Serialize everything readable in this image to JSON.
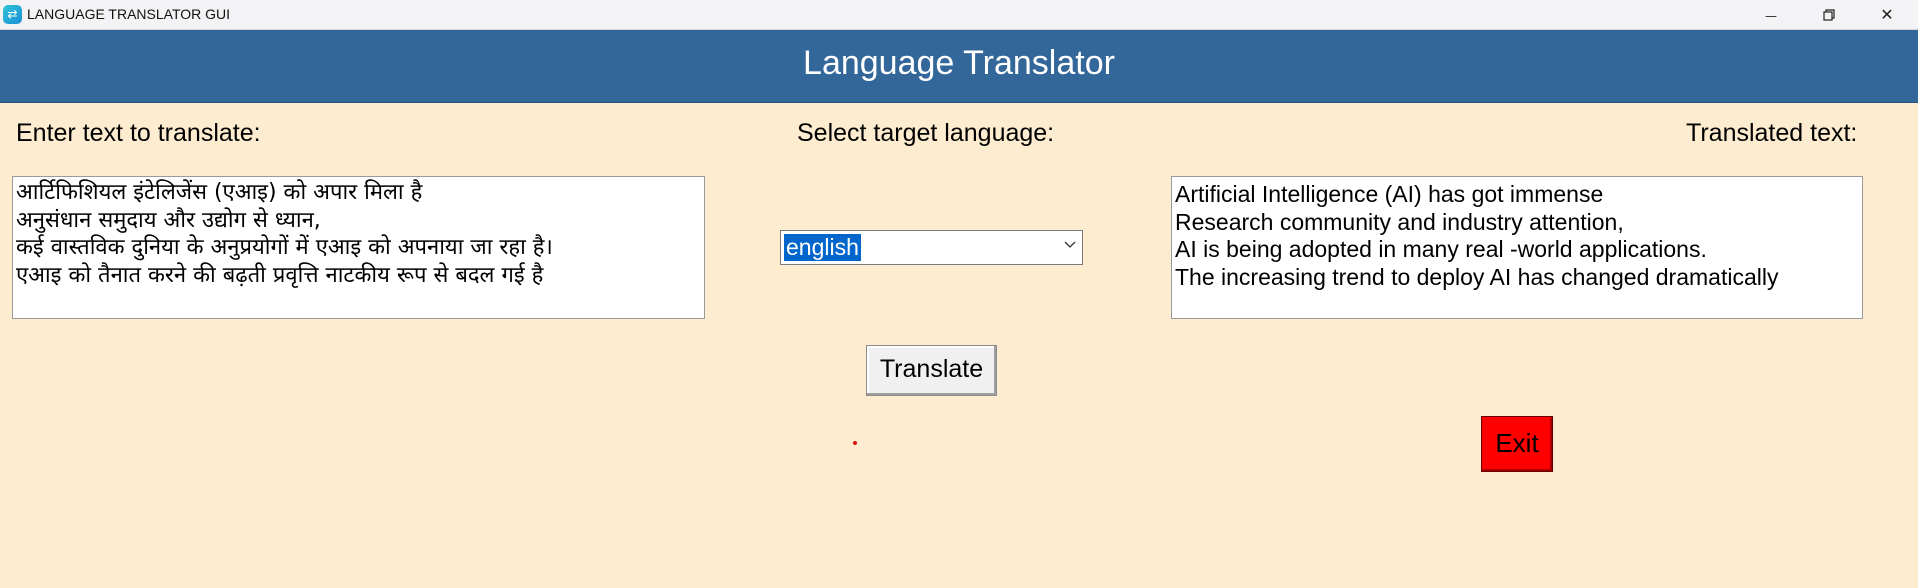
{
  "window": {
    "title": "LANGUAGE TRANSLATOR GUI",
    "minimize_symbol": "—",
    "close_symbol": "✕"
  },
  "header": {
    "title": "Language Translator"
  },
  "input": {
    "label": "Enter text to translate:",
    "text": "आर्टिफिशियल इंटेलिजेंस (एआइ) को अपार मिला है\nअनुसंधान समुदाय और उद्योग से ध्यान,\nकई वास्तविक दुनिया के अनुप्रयोगों में एआइ को अपनाया जा रहा है।\nएआइ को तैनात करने की बढ़ती प्रवृत्ति नाटकीय रूप से बदल गई है"
  },
  "language": {
    "label": "Select target language:",
    "selected": "english",
    "icon": "chevron-down-icon"
  },
  "output": {
    "label": "Translated text:",
    "text": "Artificial Intelligence (AI) has got immense\nResearch community and industry attention,\nAI is being adopted in many real -world applications.\nThe increasing trend to deploy AI has changed dramatically"
  },
  "buttons": {
    "translate": "Translate",
    "exit": "Exit"
  },
  "colors": {
    "header_bg": "#336699",
    "window_bg": "#fdeccf",
    "exit_bg": "#ff0000",
    "selection": "#0066cc"
  }
}
